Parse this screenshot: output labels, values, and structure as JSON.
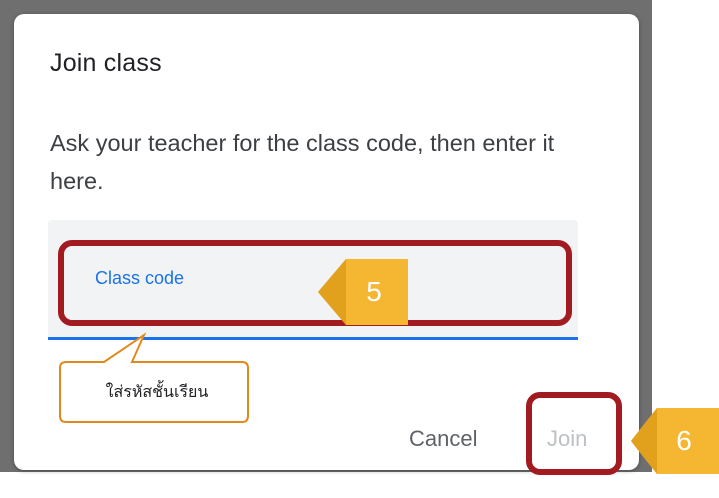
{
  "dialog": {
    "title": "Join class",
    "description": "Ask your teacher for the class code, then enter it here."
  },
  "field": {
    "label": "Class code",
    "value": ""
  },
  "buttons": {
    "cancel": "Cancel",
    "join": "Join"
  },
  "annotations": {
    "step_field": "5",
    "step_join": "6",
    "field_hint": "ใส่รหัสชั้นเรียน"
  },
  "colors": {
    "accent_blue": "#1a73e8",
    "highlight_red": "#a11b20",
    "callout_gold": "#f5b731",
    "hint_border": "#e08a1e",
    "backdrop_gray": "#6f6f6f"
  },
  "icons": {
    "callout_shape": "left-pointing-arrow-tag"
  }
}
